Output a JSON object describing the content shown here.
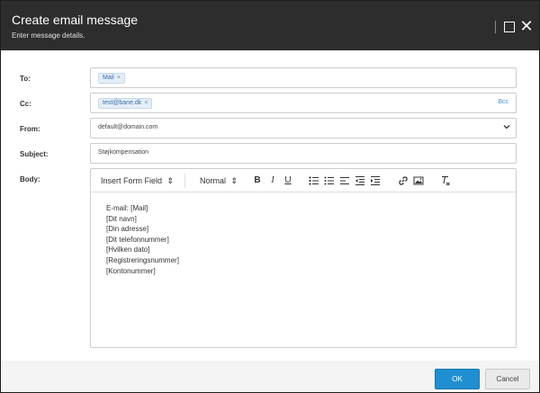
{
  "dialog": {
    "title": "Create email message",
    "subtitle": "Enter message details.",
    "maximize_icon": "square-icon",
    "close_icon": "close-icon",
    "close_glyph": "✕"
  },
  "form": {
    "to": {
      "label": "To:",
      "tags": [
        "Mail"
      ],
      "remove_glyph": "×"
    },
    "cc": {
      "label": "Cc:",
      "tags": [
        "test@bane.dk"
      ],
      "remove_glyph": "×",
      "bcc_label": "Bcc"
    },
    "from": {
      "label": "From:",
      "value": "default@domain.com",
      "chevron_glyph": "⌄"
    },
    "subject": {
      "label": "Subject:",
      "value": "Støjkompensation"
    },
    "body": {
      "label": "Body:",
      "toolbar": {
        "insert_form_field": "Insert Form Field",
        "format": "Normal",
        "updown_glyph": "⇕",
        "bold": "B",
        "italic": "I",
        "underline": "U"
      },
      "lines": [
        "E-mail: [Mail]",
        "[Dit navn]",
        "[Din adresse]",
        "[Dit telefonnummer]",
        "[Hvilken dato]",
        "[Registreringsnummer]",
        "[Kontonummer]"
      ]
    }
  },
  "footer": {
    "ok_label": "OK",
    "cancel_label": "Cancel"
  },
  "colors": {
    "header_bg": "#2d2d2d",
    "accent": "#1f8fd1",
    "tag_bg": "#e4eef8",
    "link": "#4a90c8"
  }
}
